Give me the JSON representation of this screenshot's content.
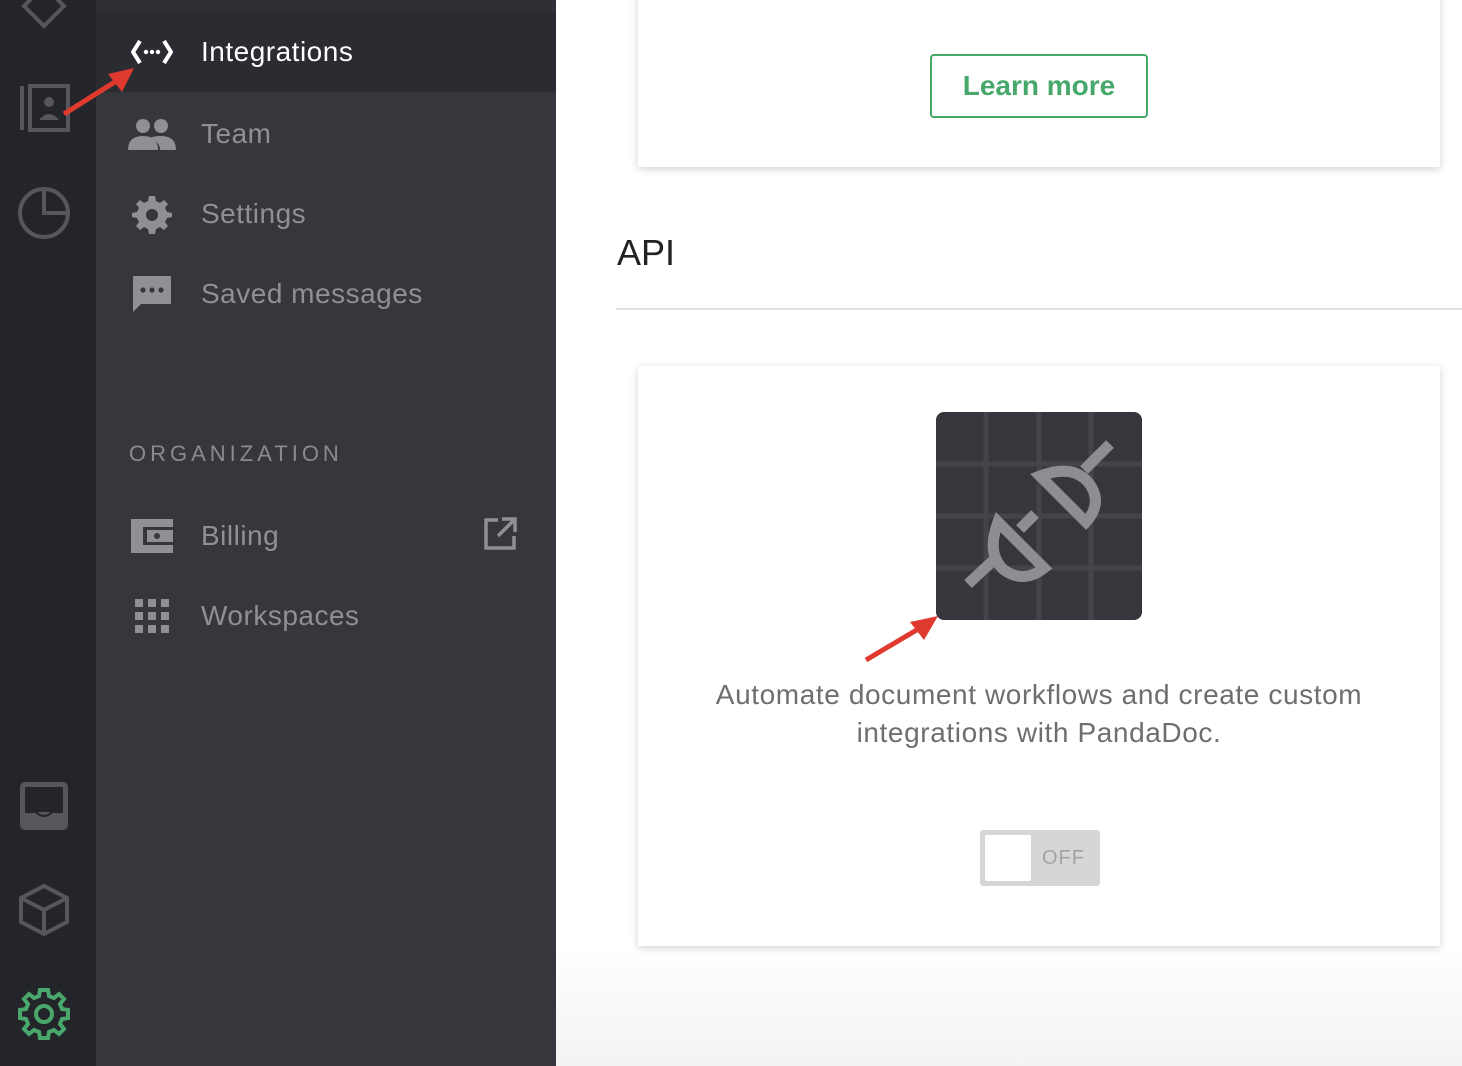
{
  "sidebar": {
    "items": [
      {
        "label": "Integrations",
        "icon": "code-arrows-icon",
        "active": true
      },
      {
        "label": "Team",
        "icon": "team-icon"
      },
      {
        "label": "Settings",
        "icon": "gear-icon"
      },
      {
        "label": "Saved messages",
        "icon": "chat-icon"
      }
    ],
    "organization_heading": "ORGANIZATION",
    "org_items": [
      {
        "label": "Billing",
        "icon": "wallet-icon"
      },
      {
        "label": "Workspaces",
        "icon": "grid-icon"
      }
    ]
  },
  "rail": {
    "icons": [
      "tag-icon",
      "contacts-icon",
      "pie-chart-icon",
      "inbox-icon",
      "cube-icon",
      "settings-gear-icon"
    ]
  },
  "main": {
    "learn_more": "Learn more",
    "api_heading": "API",
    "api_description": "Automate document workflows and create custom integrations with PandaDoc.",
    "toggle_label": "OFF",
    "toggle_on": false
  },
  "colors": {
    "accent_green": "#47a86b",
    "annotation_red": "#e03a2f",
    "sidebar_bg": "#36373c",
    "rail_bg": "#23252a"
  }
}
